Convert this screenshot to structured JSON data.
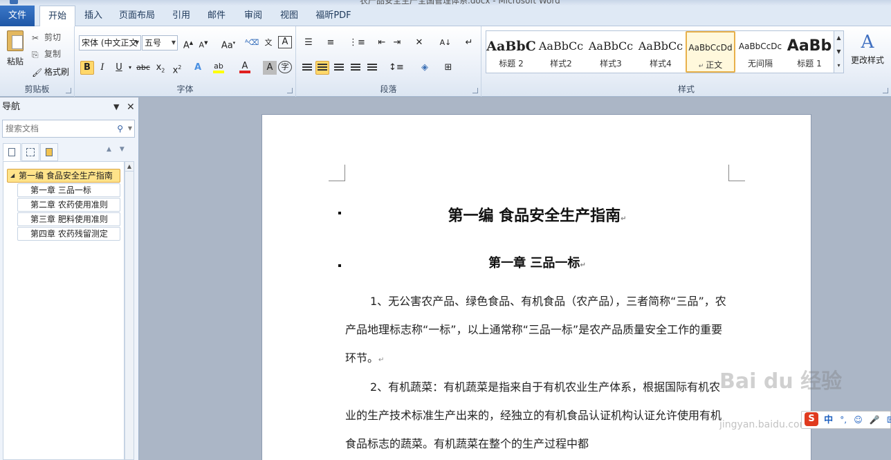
{
  "window": {
    "title": "农产品安全生产全国管理体系.docx - Microsoft Word"
  },
  "tabs": [
    "文件",
    "开始",
    "插入",
    "页面布局",
    "引用",
    "邮件",
    "审阅",
    "视图",
    "福昕PDF"
  ],
  "clipboard": {
    "paste_label": "粘贴",
    "cut_label": "剪切",
    "copy_label": "复制",
    "format_painter_label": "格式刷",
    "group_label": "剪贴板"
  },
  "font": {
    "font_name": "宋体 (中文正文",
    "font_size": "五号",
    "group_label": "字体"
  },
  "paragraph": {
    "group_label": "段落"
  },
  "styles": {
    "items": [
      {
        "sample": "AaBbC",
        "name": "标题 2"
      },
      {
        "sample": "AaBbCc",
        "name": "样式2"
      },
      {
        "sample": "AaBbCc",
        "name": "样式3"
      },
      {
        "sample": "AaBbCc",
        "name": "样式4"
      },
      {
        "sample": "AaBbCcDd",
        "name": "正文"
      },
      {
        "sample": "AaBbCcDc",
        "name": "无间隔"
      },
      {
        "sample": "AaBb",
        "name": "标题 1"
      }
    ],
    "change_styles_label": "更改样式",
    "group_label": "样式"
  },
  "nav": {
    "title": "导航",
    "search_placeholder": "搜索文档",
    "items": [
      {
        "label": "第一编 食品安全生产指南",
        "level": 1,
        "selected": true
      },
      {
        "label": "第一章 三品一标",
        "level": 2
      },
      {
        "label": "第二章 农药使用准则",
        "level": 2
      },
      {
        "label": "第三章 肥料使用准则",
        "level": 2
      },
      {
        "label": "第四章 农药残留测定",
        "level": 2
      }
    ]
  },
  "document": {
    "heading1": "第一编  食品安全生产指南",
    "heading2": "第一章  三品一标",
    "para1": "1、无公害农产品、绿色食品、有机食品（农产品），三者简称“三品”，农产品地理标志称“一标”，以上通常称“三品一标”是农产品质量安全工作的重要环节。",
    "para2": "2、有机蔬菜：有机蔬菜是指来自于有机农业生产体系，根据国际有机农业的生产技术标准生产出来的，经独立的有机食品认证机构认证允许使用有机食品标志的蔬菜。有机蔬菜在整个的生产过程中都"
  },
  "watermark": {
    "text": "Bai du 经验",
    "url": "jingyan.baidu.com"
  },
  "ime": {
    "mode": "中"
  },
  "colors": {
    "file_tab": "#2a66b8",
    "selection": "#ffe38a",
    "font_color_bar": "#e02020",
    "highlight_bar": "#ffff00"
  }
}
